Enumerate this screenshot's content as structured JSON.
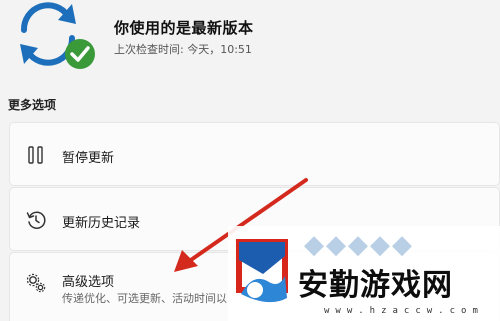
{
  "status": {
    "title": "你使用的是最新版本",
    "last_checked": "上次检查时间: 今天，10:51",
    "icon": "sync-check-icon",
    "accent_color": "#1d6fbb",
    "check_color": "#3a9a3a"
  },
  "more_options": {
    "heading": "更多选项",
    "items": [
      {
        "label": "暂停更新",
        "icon": "pause-icon"
      },
      {
        "label": "更新历史记录",
        "icon": "history-icon"
      },
      {
        "label": "高级选项",
        "description": "传递优化、可选更新、活动时间以",
        "icon": "gears-icon"
      }
    ]
  },
  "annotation": {
    "arrow_color": "#d42a1e",
    "icon": "red-arrow"
  },
  "watermark": {
    "title": "安勤游戏网",
    "url": "www.hzaccw.com"
  }
}
